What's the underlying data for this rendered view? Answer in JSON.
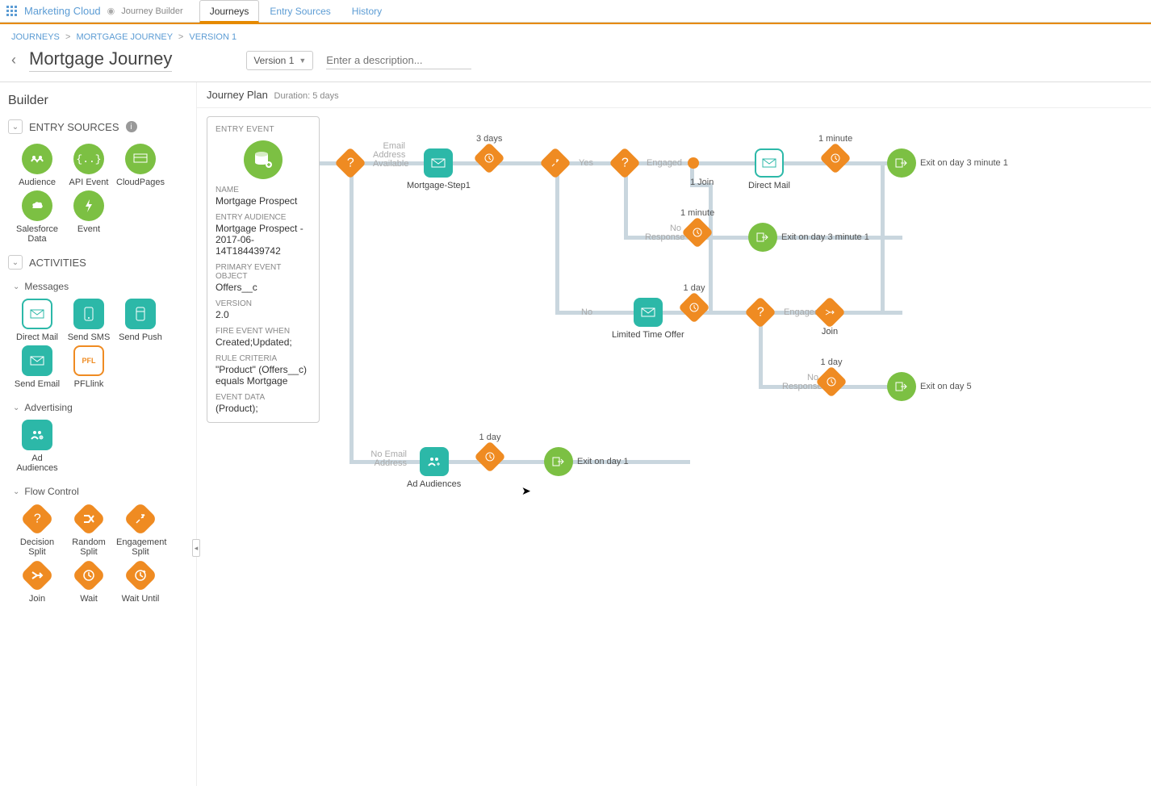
{
  "topnav": {
    "brand": "Marketing Cloud",
    "sub": "Journey Builder",
    "tabs": [
      "Journeys",
      "Entry Sources",
      "History"
    ],
    "active_tab": 0
  },
  "breadcrumb": [
    "JOURNEYS",
    "MORTGAGE JOURNEY",
    "VERSION 1"
  ],
  "page_title": "Mortgage Journey",
  "version_select": "Version 1",
  "description_placeholder": "Enter a description...",
  "sidebar": {
    "title": "Builder",
    "sections": {
      "entry_sources": {
        "label": "ENTRY SOURCES",
        "items": [
          "Audience",
          "API Event",
          "CloudPages",
          "Salesforce Data",
          "Event"
        ]
      },
      "activities": {
        "label": "ACTIVITIES",
        "groups": {
          "messages": {
            "label": "Messages",
            "items": [
              "Direct Mail",
              "Send SMS",
              "Send Push",
              "Send Email",
              "PFLlink"
            ]
          },
          "advertising": {
            "label": "Advertising",
            "items": [
              "Ad Audiences"
            ]
          },
          "flow_control": {
            "label": "Flow Control",
            "items": [
              "Decision Split",
              "Random Split",
              "Engagement Split",
              "Join",
              "Wait",
              "Wait Until"
            ]
          }
        }
      }
    }
  },
  "canvas": {
    "plan_label": "Journey Plan",
    "duration_label": "Duration: 5 days",
    "entry_event": {
      "header": "ENTRY EVENT",
      "fields": [
        {
          "label": "NAME",
          "value": "Mortgage Prospect"
        },
        {
          "label": "ENTRY AUDIENCE",
          "value": "Mortgage Prospect - 2017-06-14T184439742"
        },
        {
          "label": "PRIMARY EVENT OBJECT",
          "value": "Offers__c"
        },
        {
          "label": "VERSION",
          "value": "2.0"
        },
        {
          "label": "FIRE EVENT WHEN",
          "value": "Created;Updated;"
        },
        {
          "label": "RULE CRITERIA",
          "value": "\"Product\" (Offers__c) equals Mortgage"
        },
        {
          "label": "EVENT DATA",
          "value": "(Product);"
        }
      ]
    },
    "nodes": {
      "mortgage_step1": "Mortgage-Step1",
      "direct_mail": "Direct Mail",
      "limited_time_offer": "Limited Time Offer",
      "ad_audiences": "Ad Audiences",
      "join": "Join",
      "wait_3days": "3 days",
      "wait_1min_a": "1 minute",
      "wait_1min_b": "1 minute",
      "wait_1day_a": "1 day",
      "wait_1day_b": "1 day",
      "wait_1day_c": "1 day",
      "join_label": "1 Join",
      "exit1": "Exit on day 3 minute 1",
      "exit2": "Exit on day 3 minute 1",
      "exit3": "Exit on day 5",
      "exit4": "Exit on day 1"
    },
    "edge_labels": {
      "email_avail": "Email\nAddress\nAvailable",
      "no_email": "No Email\nAddress",
      "yes": "Yes",
      "no": "No",
      "engaged": "Engaged",
      "no_response": "No\nResponse"
    }
  }
}
